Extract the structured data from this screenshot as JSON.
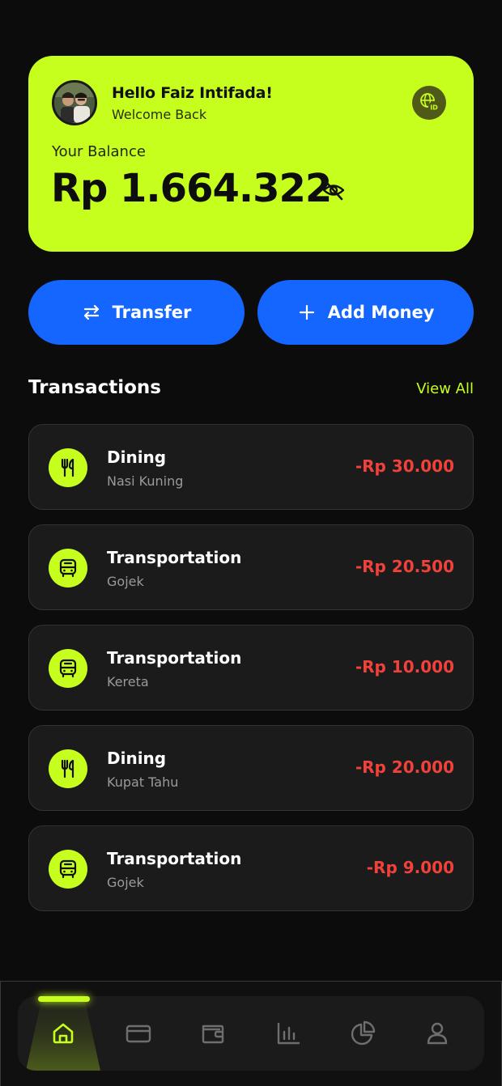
{
  "header": {
    "greeting": "Hello Faiz Intifada!",
    "welcome": "Welcome Back",
    "language_badge": "ID"
  },
  "balance": {
    "label": "Your Balance",
    "amount": "Rp 1.664.322"
  },
  "actions": {
    "transfer_label": "Transfer",
    "add_money_label": "Add Money"
  },
  "transactions": {
    "title": "Transactions",
    "view_all_label": "View All",
    "items": [
      {
        "category": "Dining",
        "note": "Nasi Kuning",
        "amount": "-Rp 30.000",
        "icon": "utensils-icon"
      },
      {
        "category": "Transportation",
        "note": "Gojek",
        "amount": "-Rp 20.500",
        "icon": "bus-icon"
      },
      {
        "category": "Transportation",
        "note": "Kereta",
        "amount": "-Rp 10.000",
        "icon": "bus-icon"
      },
      {
        "category": "Dining",
        "note": "Kupat Tahu",
        "amount": "-Rp 20.000",
        "icon": "utensils-icon"
      },
      {
        "category": "Transportation",
        "note": "Gojek",
        "amount": "-Rp 9.000",
        "icon": "bus-icon"
      }
    ]
  },
  "nav": {
    "items": [
      "home-icon",
      "card-icon",
      "wallet-icon",
      "bar-chart-icon",
      "pie-chart-icon",
      "user-icon"
    ],
    "active": "home-icon"
  },
  "colors": {
    "accent": "#c6ff1e",
    "primary_button": "#1466ff",
    "negative_amount": "#f0413b",
    "background": "#0c0c0c"
  }
}
